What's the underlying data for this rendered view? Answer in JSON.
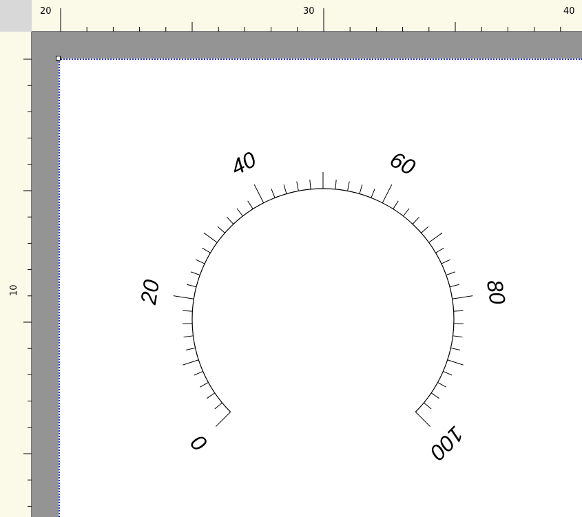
{
  "top_ruler": {
    "labels": [
      "20",
      "30",
      "40"
    ]
  },
  "left_ruler": {
    "labels": [
      "10"
    ]
  },
  "gauge": {
    "scale_labels": [
      "0",
      "20",
      "40",
      "60",
      "80",
      "100"
    ],
    "min": 0,
    "max": 100,
    "major_step": 20,
    "minor_step": 2,
    "sweep_degrees": 270
  },
  "colors": {
    "workspace": "#949494",
    "ruler": "#fbf9e8",
    "page_border": "#2a3bd6"
  }
}
